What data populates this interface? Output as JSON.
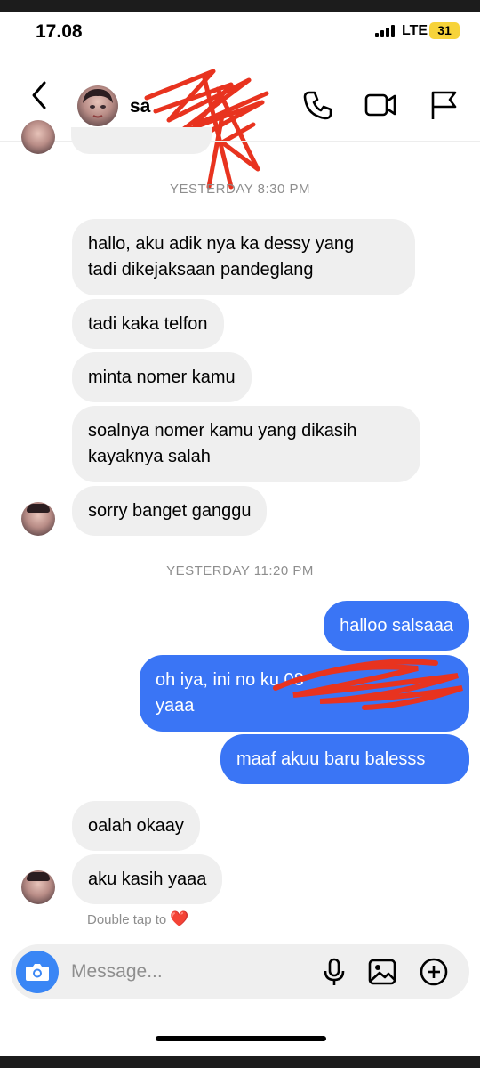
{
  "status_bar": {
    "time": "17.08",
    "network": "LTE",
    "battery": "31"
  },
  "header": {
    "contact_name_visible": "sa",
    "icons": [
      "back-icon",
      "avatar",
      "phone-icon",
      "video-icon",
      "flag-icon"
    ]
  },
  "chat": {
    "timestamps": [
      "YESTERDAY 8:30 PM",
      "YESTERDAY 11:20 PM"
    ],
    "incoming_group_1": [
      "hallo, aku adik nya ka dessy yang",
      "tadi dikejaksaan pandeglang",
      "tadi kaka telfon",
      "minta nomer kamu",
      "soalnya nomer kamu yang dikasih",
      "kayaknya salah",
      "sorry banget ganggu"
    ],
    "outgoing": [
      "halloo salsaaa",
      "oh iya, ini no ku 08",
      "yaaa",
      "maaf akuu baru balesss"
    ],
    "incoming_group_2": [
      "oalah okaay",
      "aku kasih yaaa"
    ],
    "reaction_hint": "Double tap to",
    "reaction_emoji": "❤️"
  },
  "composer": {
    "placeholder": "Message..."
  },
  "colors": {
    "outgoing_bubble": "#3a75f5",
    "incoming_bubble": "#efefef",
    "camera_button": "#3a86f5",
    "redaction": "#e8331f"
  }
}
